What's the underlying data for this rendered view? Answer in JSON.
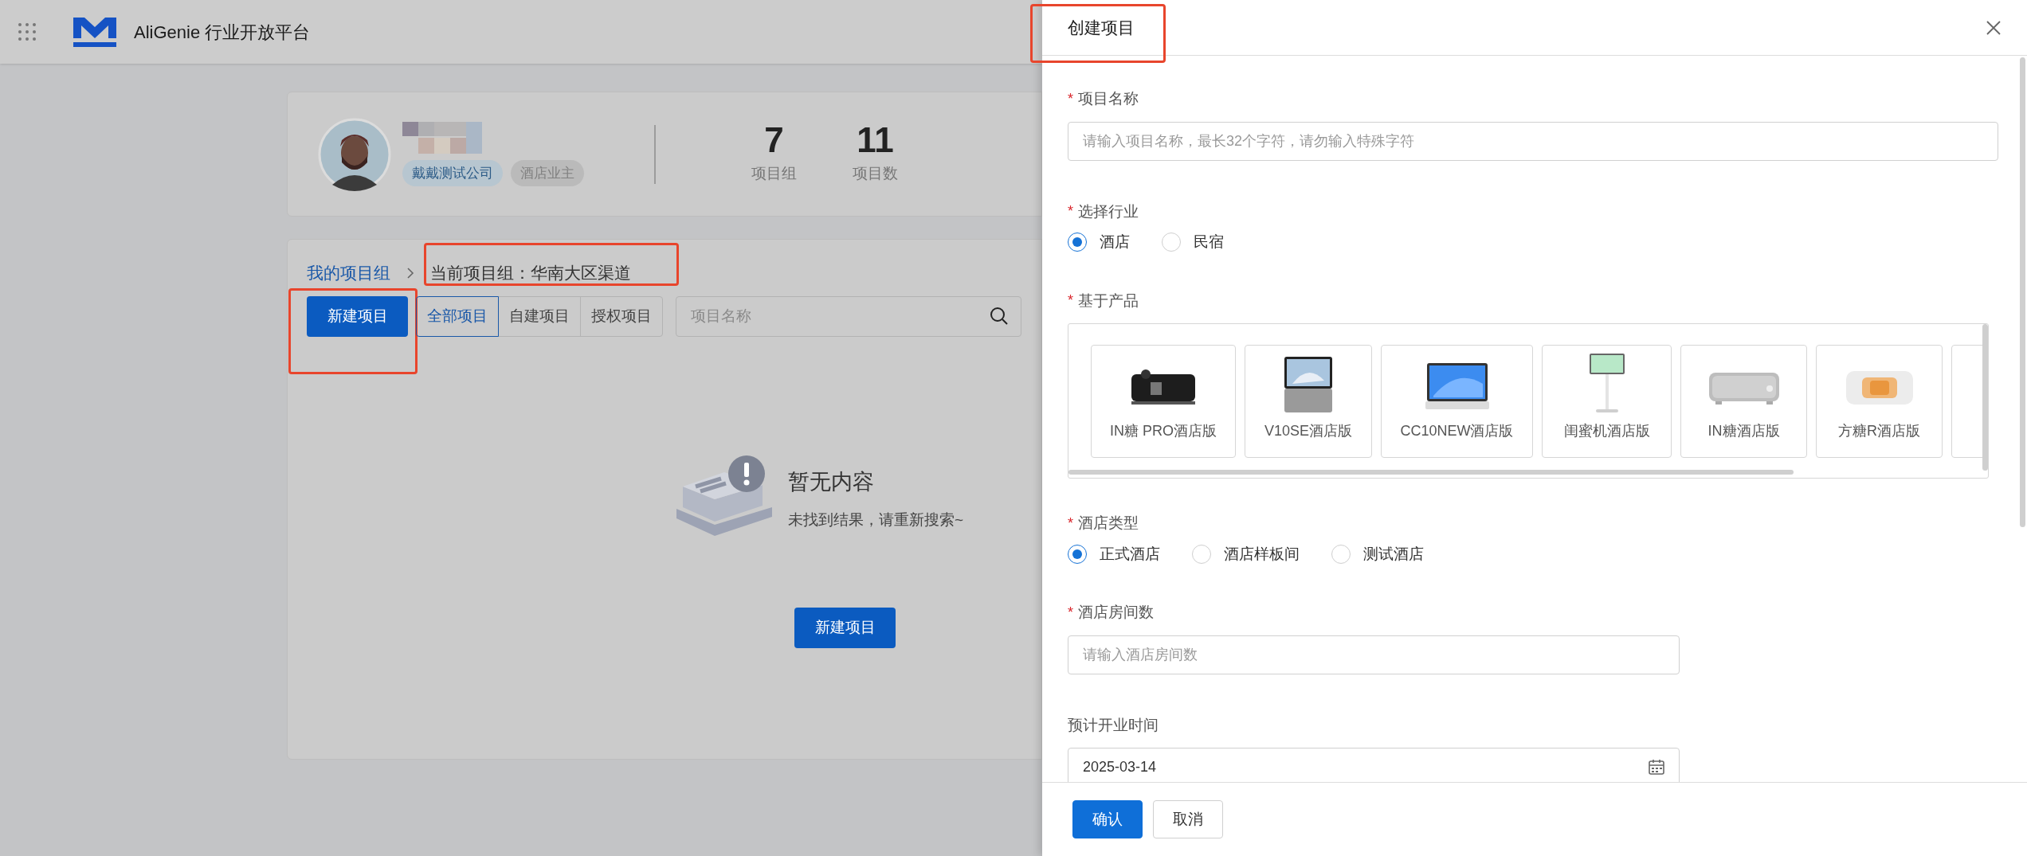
{
  "header": {
    "title": "AliGenie 行业开放平台"
  },
  "profile": {
    "company": "戴戴测试公司",
    "role": "酒店业主",
    "stats": [
      {
        "value": "7",
        "label": "项目组"
      },
      {
        "value": "11",
        "label": "项目数"
      }
    ]
  },
  "breadcrumb": {
    "root": "我的项目组",
    "current": "当前项目组：华南大区渠道"
  },
  "new_button": "新建项目",
  "filter_tabs": [
    {
      "label": "全部项目",
      "selected": true
    },
    {
      "label": "自建项目",
      "selected": false
    },
    {
      "label": "授权项目",
      "selected": false
    }
  ],
  "search": {
    "placeholder": "项目名称"
  },
  "empty_state": {
    "title": "暂无内容",
    "message": "未找到结果，请重新搜索~",
    "button": "新建项目"
  },
  "drawer": {
    "title": "创建项目",
    "fields": [
      {
        "kind": "wide_input",
        "label": "项目名称",
        "required_mark": "*",
        "placeholder": "请输入项目名称，最长32个字符，请勿输入特殊字符"
      },
      {
        "kind": "radio",
        "label": "选择行业",
        "required_mark": "*",
        "options": [
          {
            "label": "酒店",
            "selected": true
          },
          {
            "label": "民宿",
            "selected": false
          }
        ]
      },
      {
        "kind": "products",
        "label": "基于产品",
        "required_mark": "*",
        "products": [
          {
            "name": "IN糖 PRO酒店版"
          },
          {
            "name": "V10SE酒店版"
          },
          {
            "name": "CC10NEW酒店版"
          },
          {
            "name": "闺蜜机酒店版"
          },
          {
            "name": "IN糖酒店版"
          },
          {
            "name": "方糖R酒店版"
          }
        ]
      },
      {
        "kind": "radio",
        "label": "酒店类型",
        "required_mark": "*",
        "options": [
          {
            "label": "正式酒店",
            "selected": true
          },
          {
            "label": "酒店样板间",
            "selected": false
          },
          {
            "label": "测试酒店",
            "selected": false
          }
        ]
      },
      {
        "kind": "input",
        "label": "酒店房间数",
        "required_mark": "*",
        "placeholder": "请输入酒店房间数"
      },
      {
        "kind": "date",
        "label": "预计开业时间",
        "value": "2025-03-14"
      }
    ],
    "buttons": [
      {
        "label": "确认",
        "kind": "primary"
      },
      {
        "label": "取消",
        "kind": "default"
      }
    ]
  }
}
